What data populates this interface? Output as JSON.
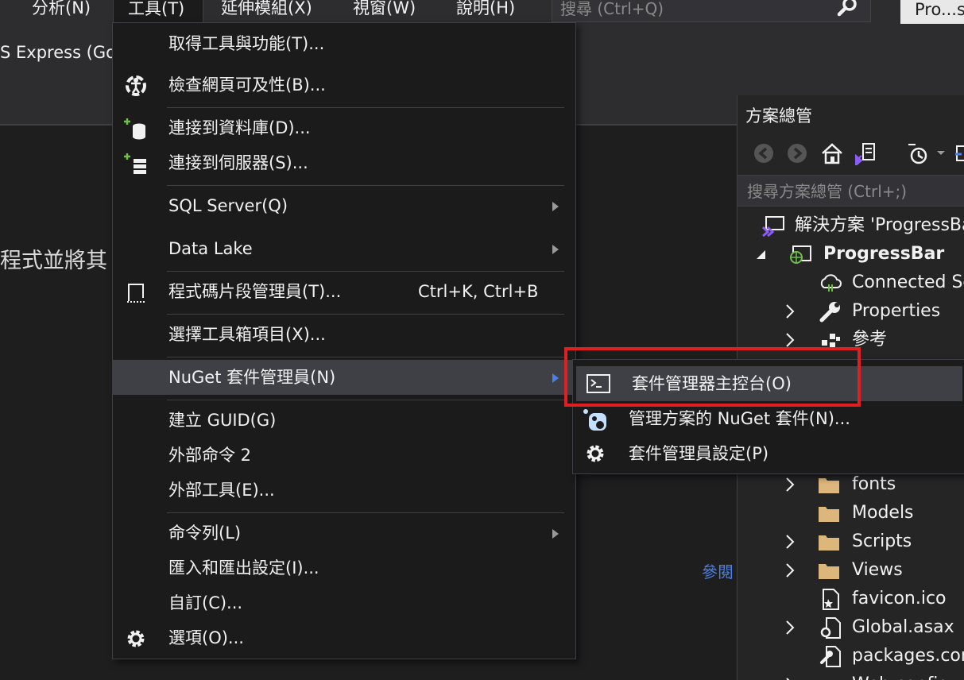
{
  "menubar": {
    "items": [
      "分析(N)",
      "工具(T)",
      "延伸模組(X)",
      "視窗(W)",
      "說明(H)"
    ],
    "search_placeholder": "搜尋 (Ctrl+Q)",
    "profile_label": "Pro...s"
  },
  "toolbar": {
    "doc_tab": "S Express (Go"
  },
  "editor": {
    "text_fragment": "程式並將其",
    "link_fragment": "參閱"
  },
  "tools_menu": {
    "items": [
      {
        "label": "取得工具與功能(T)...",
        "shortcut": ""
      },
      {
        "label": "檢查網頁可及性(B)...",
        "shortcut": ""
      },
      {
        "label": "連接到資料庫(D)...",
        "shortcut": ""
      },
      {
        "label": "連接到伺服器(S)...",
        "shortcut": ""
      },
      {
        "label": "SQL Server(Q)",
        "shortcut": ""
      },
      {
        "label": "Data Lake",
        "shortcut": ""
      },
      {
        "label": "程式碼片段管理員(T)...",
        "shortcut": "Ctrl+K, Ctrl+B"
      },
      {
        "label": "選擇工具箱項目(X)...",
        "shortcut": ""
      },
      {
        "label": "NuGet 套件管理員(N)",
        "shortcut": ""
      },
      {
        "label": "建立 GUID(G)",
        "shortcut": ""
      },
      {
        "label": "外部命令 2",
        "shortcut": ""
      },
      {
        "label": "外部工具(E)...",
        "shortcut": ""
      },
      {
        "label": "命令列(L)",
        "shortcut": ""
      },
      {
        "label": "匯入和匯出設定(I)...",
        "shortcut": ""
      },
      {
        "label": "自訂(C)...",
        "shortcut": ""
      },
      {
        "label": "選項(O)...",
        "shortcut": ""
      }
    ]
  },
  "nuget_submenu": {
    "items": [
      {
        "label": "套件管理器主控台(O)"
      },
      {
        "label": "管理方案的 NuGet 套件(N)..."
      },
      {
        "label": "套件管理員設定(P)"
      }
    ]
  },
  "solution_explorer": {
    "title": "方案總管",
    "search_placeholder": "搜尋方案總管 (Ctrl+;)",
    "tree": [
      {
        "label": "解決方案 'ProgressBar'"
      },
      {
        "label": "ProgressBar"
      },
      {
        "label": "Connected Services"
      },
      {
        "label": "Properties"
      },
      {
        "label": "參考"
      },
      {
        "label": "fonts"
      },
      {
        "label": "Models"
      },
      {
        "label": "Scripts"
      },
      {
        "label": "Views"
      },
      {
        "label": "favicon.ico"
      },
      {
        "label": "Global.asax"
      },
      {
        "label": "packages.config"
      },
      {
        "label": "Web.config"
      }
    ]
  },
  "colors": {
    "highlight_box": "#e02020",
    "menu_bg": "#1b1b1c",
    "menu_hover": "#3f3f46",
    "folder": "#dcb67a",
    "vs_purple": "#8b5cf6",
    "link": "#4a7ee8"
  }
}
